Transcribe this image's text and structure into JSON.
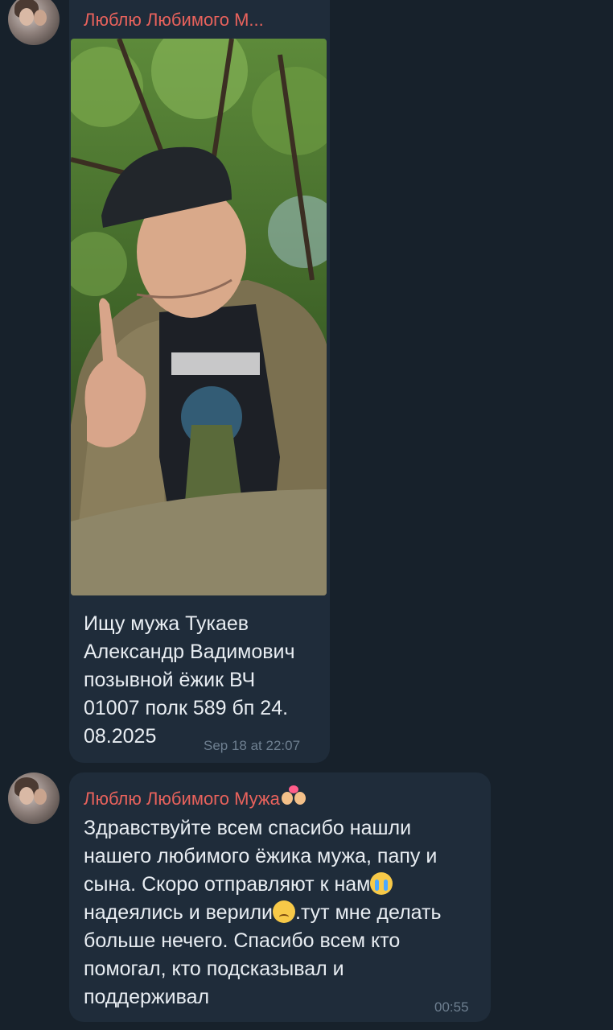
{
  "messages": [
    {
      "sender": "Люблю Любимого М...",
      "caption_lines": [
        "Ищу мужа Тукаев",
        "Александр Вадимович",
        "позывной ёжик ВЧ",
        "01007 полк 589 бп 24.",
        "08.2025"
      ],
      "time": "Sep 18 at 22:07"
    },
    {
      "sender": "Люблю Любимого Мужа",
      "sender_emoji": "couple-with-heart-emoji",
      "lines": [
        {
          "text": "Здравствуйте всем спасибо нашли"
        },
        {
          "text": "нашего любимого ёжика мужа, папу и"
        },
        {
          "text": "сына. Скоро отправляют к нам",
          "emoji": "crying-face-emoji"
        },
        {
          "text": "надеялись и верили",
          "emoji": "pensive-face-emoji",
          "after": ".тут мне делать"
        },
        {
          "text": "больше нечего. Спасибо всем кто"
        },
        {
          "text": "помогал, кто подсказывал и"
        },
        {
          "text": "поддерживал"
        }
      ],
      "time": "00:55"
    }
  ],
  "colors": {
    "background": "#17212b",
    "bubble": "#1f2c3a",
    "sender": "#e8625c",
    "text": "#e8edf2",
    "time": "#6e7f90"
  }
}
